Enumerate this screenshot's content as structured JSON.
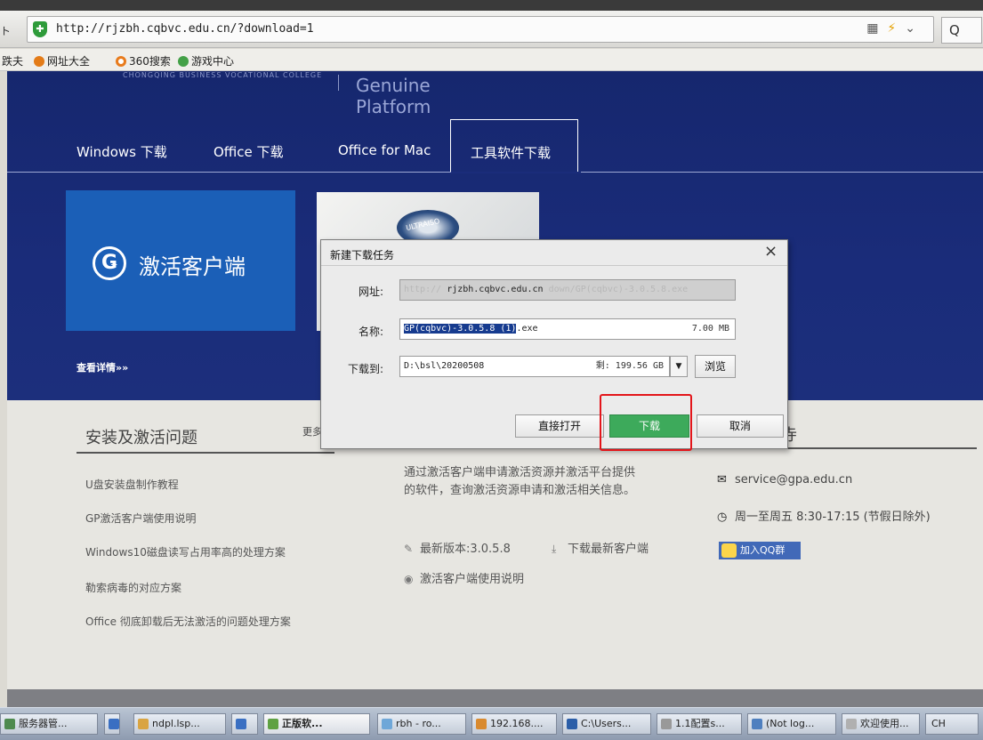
{
  "browser": {
    "url": "http://rjzbh.cqbvc.edu.cn/?download=1",
    "search_icon": "Q",
    "left_cut": "ト",
    "favorites": [
      {
        "label": "跌夫",
        "icon": "folder-icon"
      },
      {
        "label": "网址大全",
        "icon": "globe-icon"
      },
      {
        "label": "360搜索",
        "icon": "search-icon"
      },
      {
        "label": "游戏中心",
        "icon": "game-icon"
      }
    ],
    "colors": {
      "shield": "#2e9b3a",
      "bolt": "#e4a000"
    }
  },
  "site": {
    "school_name": "CHONGQING BUSINESS VOCATIONAL COLLEGE",
    "platform": "Genuine Platform",
    "tabs": [
      "Windows 下载",
      "Office 下载",
      "Office for Mac",
      "工具软件下载"
    ],
    "active_tab": "工具软件下载",
    "card_activate_label": "激活客户端",
    "card_ultraiso_label": "ULTRAISO",
    "details_link": "查看详情»»",
    "details_link2": "查",
    "colors": {
      "header_bg": "#1a2c7a",
      "card_blue": "#1b5fb7"
    }
  },
  "questions": {
    "title": "安装及激活问题",
    "more": "更多",
    "items": [
      "U盘安装盘制作教程",
      "GP激活客户端使用说明",
      "Windows10磁盘读写占用率高的处理方案",
      "勒索病毒的对应方案",
      "Office 彻底卸载后无法激活的问题处理方案"
    ]
  },
  "middle": {
    "description": "通过激活客户端申请激活资源并激活平台提供的软件，查询激活资源申请和激活相关信息。",
    "version": "最新版本:3.0.5.8",
    "download_client": "下载最新客户端",
    "usage": "激活客户端使用说明"
  },
  "contact": {
    "title_tail": "寺",
    "email": "service@gpa.edu.cn",
    "hours": "周一至周五 8:30-17:15 (节假日除外)",
    "qq_group": "加入QQ群"
  },
  "dialog": {
    "title": "新建下载任务",
    "url_label": "网址:",
    "url_prefix": "http://",
    "url_host": "rjzbh.cqbvc.edu.cn",
    "url_path": "down/GP(cqbvc)-3.0.5.8.exe",
    "name_label": "名称:",
    "name_selected": "GP(cqbvc)-3.0.5.8 (1)",
    "name_ext": ".exe",
    "size": "7.00 MB",
    "save_label": "下载到:",
    "path": "D:\\bsl\\20200508",
    "free_space": "剩: 199.56 GB",
    "browse": "浏览",
    "open_directly": "直接打开",
    "download": "下载",
    "cancel": "取消",
    "colors": {
      "download_btn": "#3daa5b",
      "highlight": "#e3151a"
    }
  },
  "taskbar": {
    "items": [
      {
        "label": "服务器管...",
        "icon_color": "#4e8a4e"
      },
      {
        "label": "ndpl.lsp...",
        "icon_color": "#d9a441"
      },
      {
        "label": "",
        "icon_color": "#3a6fc2"
      },
      {
        "label": "正版软...",
        "icon_color": "#5fa142",
        "active": true
      },
      {
        "label": "rbh - ro...",
        "icon_color": "#6fa7d8"
      },
      {
        "label": "192.168....",
        "icon_color": "#d98a2f"
      },
      {
        "label": "C:\\Users...",
        "icon_color": "#2b5ea8"
      },
      {
        "label": "1.1配置s...",
        "icon_color": "#999999"
      },
      {
        "label": "(Not log...",
        "icon_color": "#4e7fbf"
      },
      {
        "label": "欢迎使用...",
        "icon_color": "#b0b0b0"
      },
      {
        "label": "CH",
        "icon_color": "#ffffff"
      }
    ]
  }
}
